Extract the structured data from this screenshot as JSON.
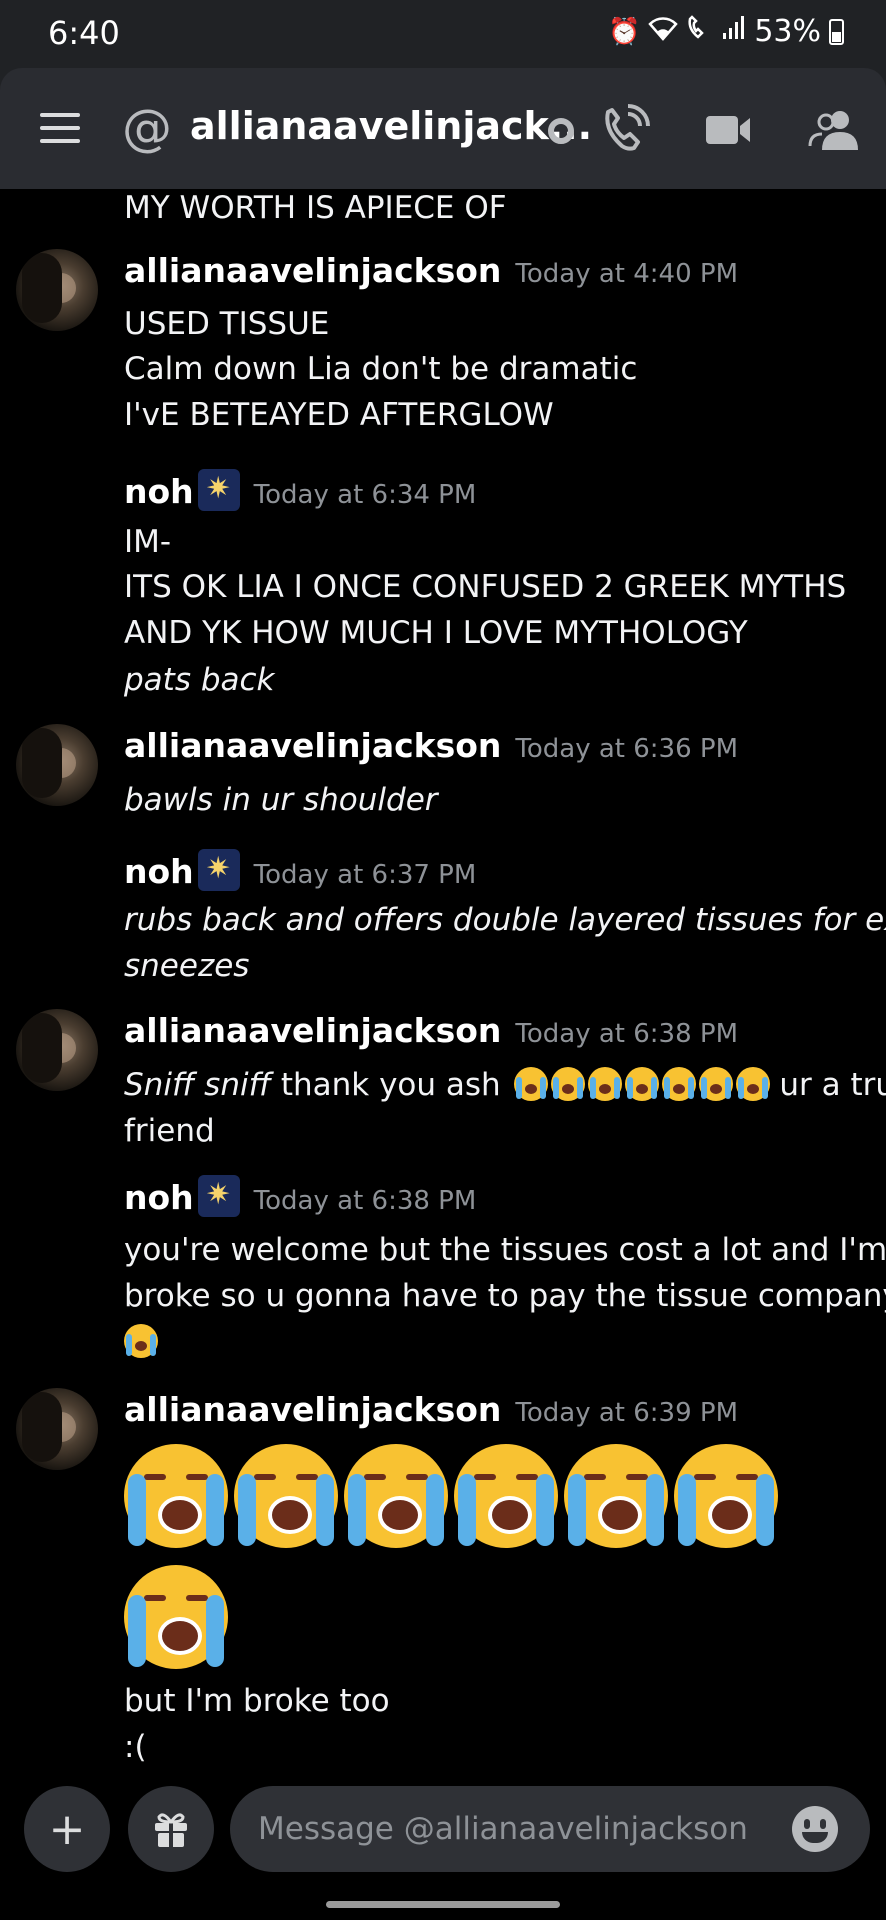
{
  "status_bar": {
    "time": "6:40",
    "battery": "53%"
  },
  "header": {
    "channel_name": "allianaavelinjack..."
  },
  "messages": {
    "top_line": "MY WORTH IS APIECE OF",
    "g1": {
      "author": "allianaavelinjackson",
      "time": "Today at 4:40 PM",
      "lines": [
        "USED TISSUE",
        "Calm down Lia don't be dramatic",
        "I'vE BETEAYED AFTERGLOW"
      ]
    },
    "g2": {
      "author": "noh",
      "time": "Today at 6:34 PM",
      "lines": [
        "IM-",
        "ITS OK LIA I ONCE CONFUSED 2 GREEK MYTHS",
        "AND YK HOW MUCH I LOVE MYTHOLOGY",
        "pats back"
      ]
    },
    "g3": {
      "author": "allianaavelinjackson",
      "time": "Today at 6:36 PM",
      "lines": [
        "bawls in ur shoulder"
      ]
    },
    "g4": {
      "author": "noh",
      "time": "Today at 6:37 PM",
      "lines": [
        "rubs back and offers double layered tissues for extra",
        "sneezes"
      ]
    },
    "g5": {
      "author": "allianaavelinjackson",
      "time": "Today at 6:38 PM",
      "italic_part": "Sniff sniff",
      "text_part": "thank you ash",
      "after_emoji": "ur a true",
      "line2": "friend"
    },
    "g6": {
      "author": "noh",
      "time": "Today at 6:38 PM",
      "lines": [
        "you're welcome but the tissues cost a lot and I'm",
        "broke so u gonna have to pay the tissue company"
      ]
    },
    "g7": {
      "author": "allianaavelinjackson",
      "time": "Today at 6:39 PM",
      "lines": [
        "but I'm broke too",
        ":("
      ]
    }
  },
  "composer": {
    "placeholder": "Message @allianaavelinjackson"
  },
  "icons": [
    "menu-icon",
    "at-icon",
    "call-icon",
    "video-icon",
    "members-icon",
    "plus-icon",
    "gift-icon",
    "emoji-icon",
    "loudly-crying-face-emoji",
    "sparkler-emoji"
  ]
}
